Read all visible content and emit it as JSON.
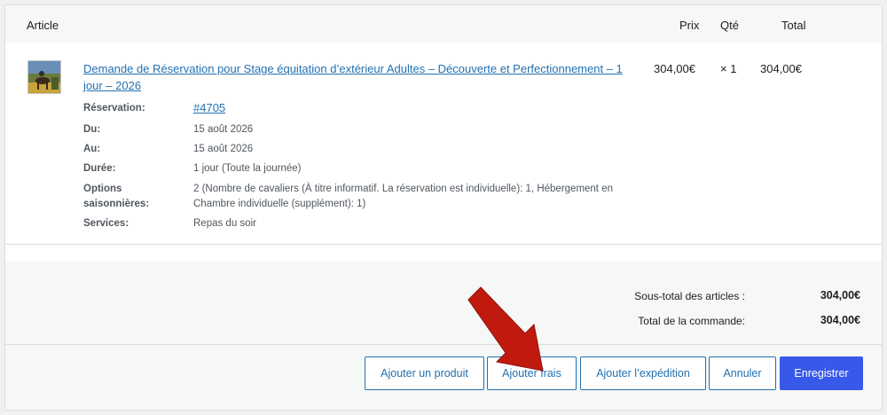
{
  "header": {
    "article": "Article",
    "price": "Prix",
    "qty": "Qté",
    "total": "Total"
  },
  "item": {
    "thumbnail_icon": "horse-riding-photo",
    "title": "Demande de Réservation pour Stage équitation d’extérieur Adultes – Découverte et Perfectionnement – 1 jour – 2026",
    "price": "304,00€",
    "qty": "× 1",
    "total": "304,00€",
    "meta": [
      {
        "key": "Réservation:",
        "value": "#4705"
      },
      {
        "key": "Du:",
        "value": "15 août 2026"
      },
      {
        "key": "Au:",
        "value": "15 août 2026"
      },
      {
        "key": "Durée:",
        "value": "1 jour (Toute la journée)"
      },
      {
        "key": "Options saisonnières:",
        "value": "2 (Nombre de cavaliers (À titre informatif. La réservation est individuelle): 1, Hébergement en Chambre individuelle (supplément): 1)"
      },
      {
        "key": "Services:",
        "value": "Repas du soir"
      }
    ]
  },
  "totals": {
    "subtotal_label": "Sous-total des articles :",
    "subtotal_value": "304,00€",
    "order_total_label": "Total de la commande:",
    "order_total_value": "304,00€"
  },
  "buttons": {
    "add_product": "Ajouter un produit",
    "add_fee": "Ajouter frais",
    "add_shipping": "Ajouter l’expédition",
    "cancel": "Annuler",
    "save": "Enregistrer"
  },
  "colors": {
    "link": "#2271b1",
    "primary": "#3858e9",
    "arrow": "#c01a0f"
  }
}
